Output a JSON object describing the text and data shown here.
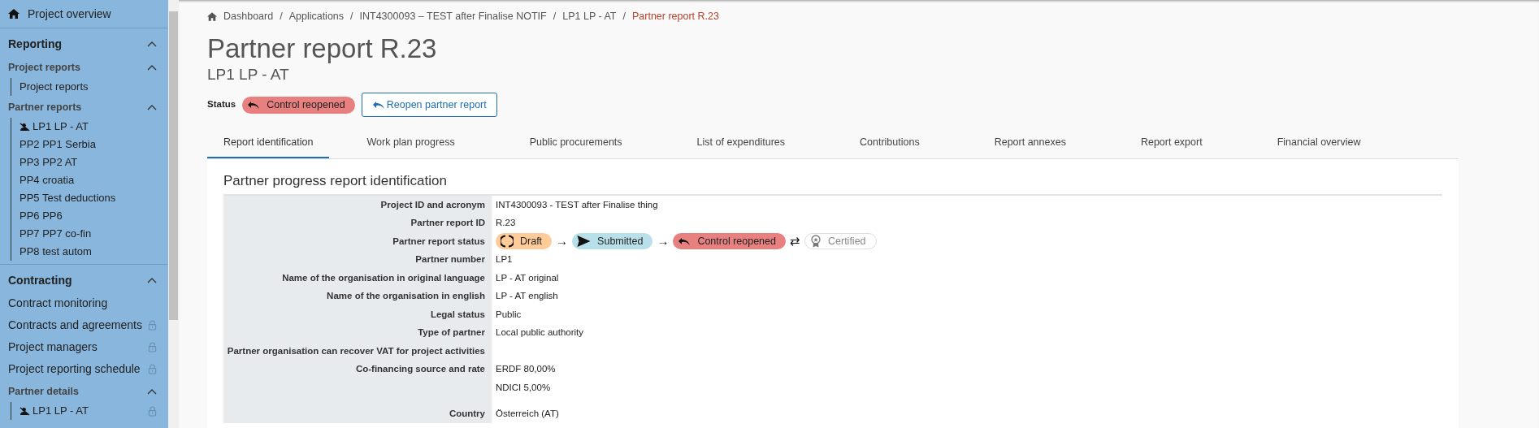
{
  "sidebar": {
    "top_item": {
      "label": "Project overview"
    },
    "sections": [
      {
        "title": "Reporting",
        "expanded": true,
        "groups": [
          {
            "title": "Project reports",
            "expanded": true,
            "items": [
              {
                "label": "Project reports",
                "lead": false,
                "locked": false
              }
            ]
          },
          {
            "title": "Partner reports",
            "expanded": true,
            "items": [
              {
                "label": "LP1 LP - AT",
                "lead": true,
                "locked": false
              },
              {
                "label": "PP2 PP1 Serbia",
                "lead": false,
                "locked": false
              },
              {
                "label": "PP3 PP2 AT",
                "lead": false,
                "locked": false
              },
              {
                "label": "PP4 croatia",
                "lead": false,
                "locked": false
              },
              {
                "label": "PP5 Test deductions",
                "lead": false,
                "locked": false
              },
              {
                "label": "PP6 PP6",
                "lead": false,
                "locked": false
              },
              {
                "label": "PP7 PP7 co-fin",
                "lead": false,
                "locked": false
              },
              {
                "label": "PP8 test autom",
                "lead": false,
                "locked": false
              }
            ]
          }
        ]
      },
      {
        "title": "Contracting",
        "expanded": true,
        "links": [
          {
            "label": "Contract monitoring",
            "locked": false
          },
          {
            "label": "Contracts and agreements",
            "locked": true
          },
          {
            "label": "Project managers",
            "locked": true
          },
          {
            "label": "Project reporting schedule",
            "locked": true
          }
        ],
        "groups": [
          {
            "title": "Partner details",
            "expanded": true,
            "items": [
              {
                "label": "LP1 LP - AT",
                "lead": true,
                "locked": true
              }
            ]
          }
        ]
      }
    ]
  },
  "breadcrumb": [
    {
      "label": "Dashboard",
      "separator": "/"
    },
    {
      "label": "Applications",
      "separator": "/"
    },
    {
      "label": "INT4300093 – TEST after Finalise NOTIF",
      "separator": "/"
    },
    {
      "label": "LP1 LP - AT",
      "separator": "/"
    },
    {
      "label": "Partner report R.23"
    }
  ],
  "title": "Partner report R.23",
  "subtitle": "LP1 LP - AT",
  "status": {
    "label": "Status",
    "chip": {
      "label": "Control reopened",
      "kind": "reopened",
      "color": "#e88080"
    },
    "button": "Reopen partner report"
  },
  "tabs": [
    {
      "label": "Report identification",
      "selected": true
    },
    {
      "label": "Work plan progress",
      "selected": false
    },
    {
      "label": "Public procurements",
      "selected": false
    },
    {
      "label": "List of expenditures",
      "selected": false
    },
    {
      "label": "Contributions",
      "selected": false
    },
    {
      "label": "Report annexes",
      "selected": false
    },
    {
      "label": "Report export",
      "selected": false
    },
    {
      "label": "Financial overview",
      "selected": false
    }
  ],
  "card": {
    "title": "Partner progress report identification",
    "rows": [
      {
        "label": "Project ID and acronym",
        "values": [
          "INT4300093 - TEST after Finalise thing"
        ]
      },
      {
        "label": "Partner report ID",
        "values": [
          "R.23"
        ]
      },
      {
        "label": "Partner report status",
        "kind": "status_flow",
        "flow": [
          {
            "label": "Draft",
            "kind": "draft",
            "color": "#ffcc99",
            "reached": true,
            "connector": "→"
          },
          {
            "label": "Submitted",
            "kind": "submitted",
            "color": "#b8e0ea",
            "reached": true,
            "connector": "→"
          },
          {
            "label": "Control reopened",
            "kind": "reopened",
            "color": "#e88080",
            "reached": true,
            "connector": "⇄"
          },
          {
            "label": "Certified",
            "kind": "certified",
            "color": "#ffffff",
            "reached": false
          }
        ]
      },
      {
        "label": "Partner number",
        "values": [
          "LP1"
        ]
      },
      {
        "label": "Name of the organisation in original language",
        "values": [
          "LP - AT original"
        ]
      },
      {
        "label": "Name of the organisation in english",
        "values": [
          "LP - AT english"
        ]
      },
      {
        "label": "Legal status",
        "values": [
          "Public"
        ]
      },
      {
        "label": "Type of partner",
        "values": [
          "Local public authority"
        ]
      },
      {
        "label": "Partner organisation can recover VAT for project activities"
      },
      {
        "label": "Co-financing source and rate",
        "values": [
          "ERDF 80,00%",
          "NDICI 5,00%"
        ]
      },
      {
        "label": "Country",
        "values": [
          "Österreich (AT)"
        ]
      }
    ]
  }
}
